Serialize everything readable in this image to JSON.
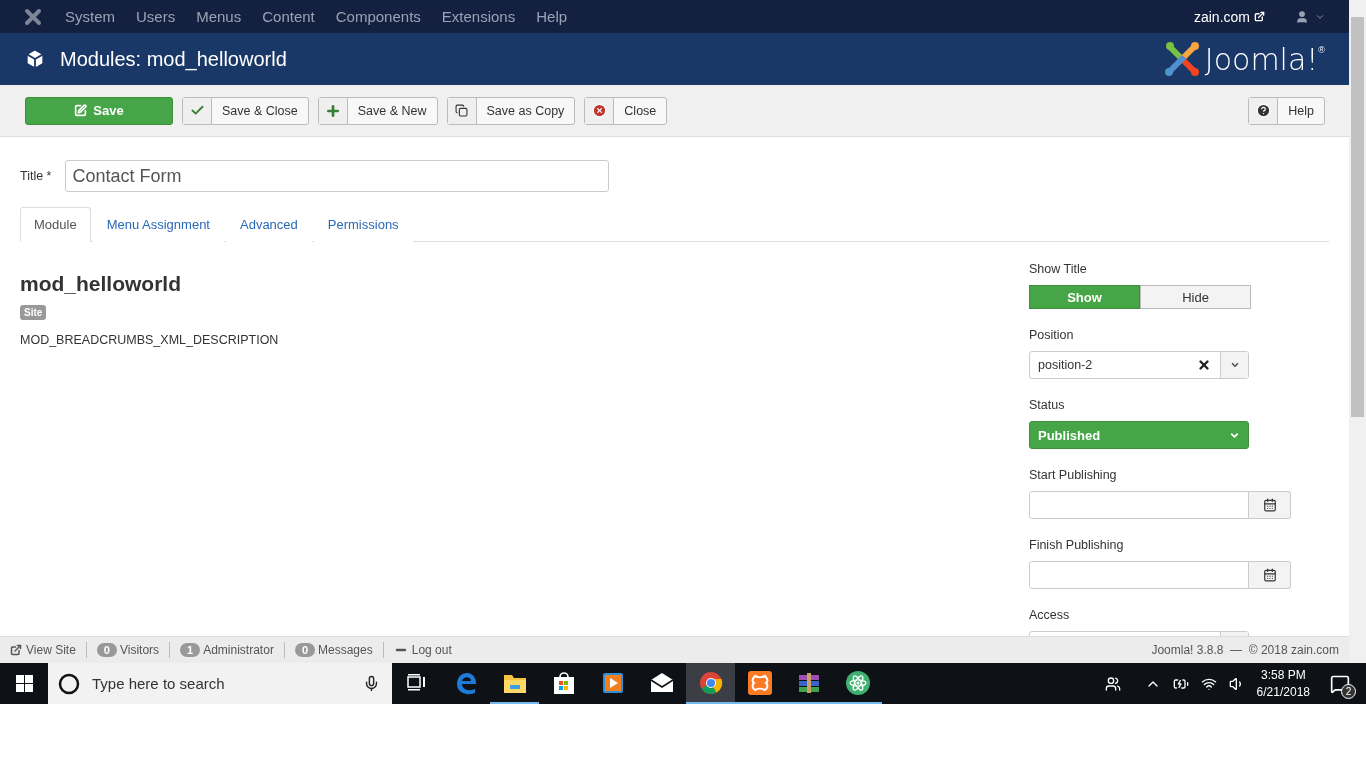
{
  "top_menu": {
    "items": [
      "System",
      "Users",
      "Menus",
      "Content",
      "Components",
      "Extensions",
      "Help"
    ],
    "site_link": "zain.com"
  },
  "header": {
    "title": "Modules: mod_helloworld",
    "logo_text": "Joomla!",
    "logo_mark": "®"
  },
  "toolbar": {
    "buttons": [
      {
        "label": "Save",
        "kind": "primary"
      },
      {
        "label": "Save & Close",
        "kind": "default"
      },
      {
        "label": "Save & New",
        "kind": "default"
      },
      {
        "label": "Save as Copy",
        "kind": "default"
      },
      {
        "label": "Close",
        "kind": "default"
      }
    ],
    "help": "Help"
  },
  "title_field": {
    "label": "Title *",
    "value": "Contact Form"
  },
  "tabs": [
    {
      "label": "Module",
      "selected": true
    },
    {
      "label": "Menu Assignment",
      "selected": false
    },
    {
      "label": "Advanced",
      "selected": false
    },
    {
      "label": "Permissions",
      "selected": false
    }
  ],
  "module": {
    "name": "mod_helloworld",
    "badge": "Site",
    "description": "MOD_BREADCRUMBS_XML_DESCRIPTION"
  },
  "options": {
    "show_title": {
      "label": "Show Title",
      "choices": [
        {
          "label": "Show",
          "selected": true
        },
        {
          "label": "Hide",
          "selected": false
        }
      ]
    },
    "position": {
      "label": "Position",
      "value": "position-2"
    },
    "status": {
      "label": "Status",
      "value": "Published"
    },
    "start_publishing": {
      "label": "Start Publishing"
    },
    "finish_publishing": {
      "label": "Finish Publishing"
    },
    "access": {
      "label": "Access"
    }
  },
  "status_bar": {
    "view_site": "View Site",
    "counters": [
      {
        "count": "0",
        "label": "Visitors"
      },
      {
        "count": "1",
        "label": "Administrator"
      },
      {
        "count": "0",
        "label": "Messages"
      }
    ],
    "logout": "Log out",
    "version": "Joomla! 3.8.8  —  © 2018 zain.com"
  },
  "taskbar": {
    "search_placeholder": "Type here to search",
    "apps": [
      {
        "running": false,
        "active": false
      },
      {
        "running": false,
        "active": false
      },
      {
        "running": true,
        "active": false
      },
      {
        "running": false,
        "active": false
      },
      {
        "running": false,
        "active": false
      },
      {
        "running": false,
        "active": false
      },
      {
        "running": true,
        "active": true
      },
      {
        "running": true,
        "active": false
      },
      {
        "running": true,
        "active": false
      },
      {
        "running": true,
        "active": false
      }
    ],
    "time": "3:58 PM",
    "date": "6/21/2018",
    "notifications": "2"
  }
}
